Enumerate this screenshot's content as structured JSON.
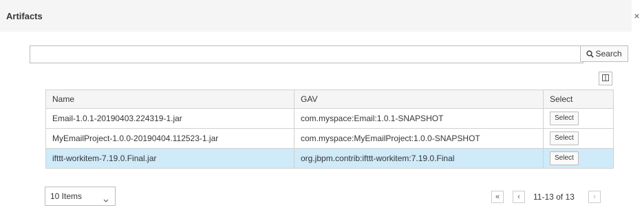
{
  "modal": {
    "title": "Artifacts",
    "close_label": "×"
  },
  "search": {
    "value": "",
    "placeholder": "",
    "button_label": "Search"
  },
  "table": {
    "columns": [
      "Name",
      "GAV",
      "Select"
    ],
    "rows": [
      {
        "name": "Email-1.0.1-20190403.224319-1.jar",
        "gav": "com.myspace:Email:1.0.1-SNAPSHOT",
        "action": "Select",
        "selected": false
      },
      {
        "name": "MyEmailProject-1.0.0-20190404.112523-1.jar",
        "gav": "com.myspace:MyEmailProject:1.0.0-SNAPSHOT",
        "action": "Select",
        "selected": false
      },
      {
        "name": "ifttt-workitem-7.19.0.Final.jar",
        "gav": "org.jbpm.contrib:ifttt-workitem:7.19.0.Final",
        "action": "Select",
        "selected": true
      }
    ]
  },
  "pagination": {
    "page_size_label": "10 Items",
    "first_label": "«",
    "prev_label": "‹",
    "next_label": "›",
    "range_text": "11-13 of 13"
  },
  "colors": {
    "header_bg": "#f5f5f5",
    "selected_row_bg": "#cfeaf8",
    "border": "#d1d1d1"
  },
  "icons": {
    "search": "search-icon",
    "columns": "column-toggle-icon",
    "dropdown": "chevron-down-icon"
  }
}
